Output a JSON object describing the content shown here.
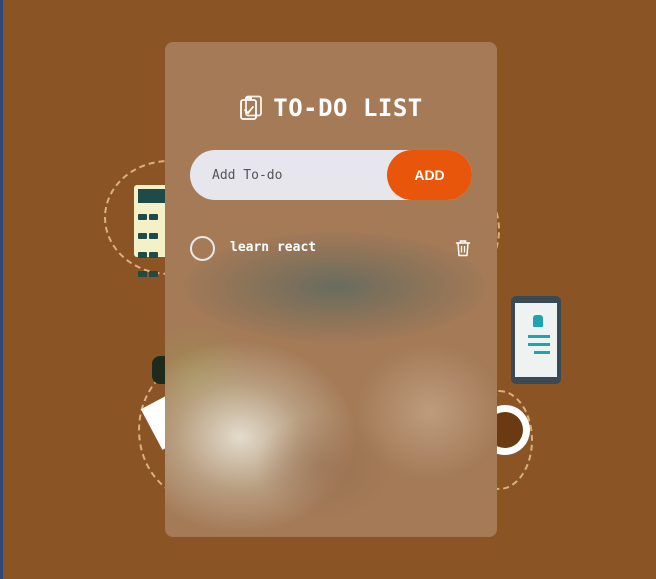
{
  "app": {
    "title": "TO-DO LIST",
    "title_icon": "clipboard-check-icon"
  },
  "input": {
    "placeholder": "Add To-do",
    "value": "",
    "add_label": "ADD"
  },
  "todos": [
    {
      "label": "learn react",
      "done": false,
      "delete_icon": "trash-icon"
    }
  ],
  "colors": {
    "background": "#8B5425",
    "card": "#a47a57",
    "accent": "#e8560c",
    "input_bg": "#e6e6ec"
  }
}
